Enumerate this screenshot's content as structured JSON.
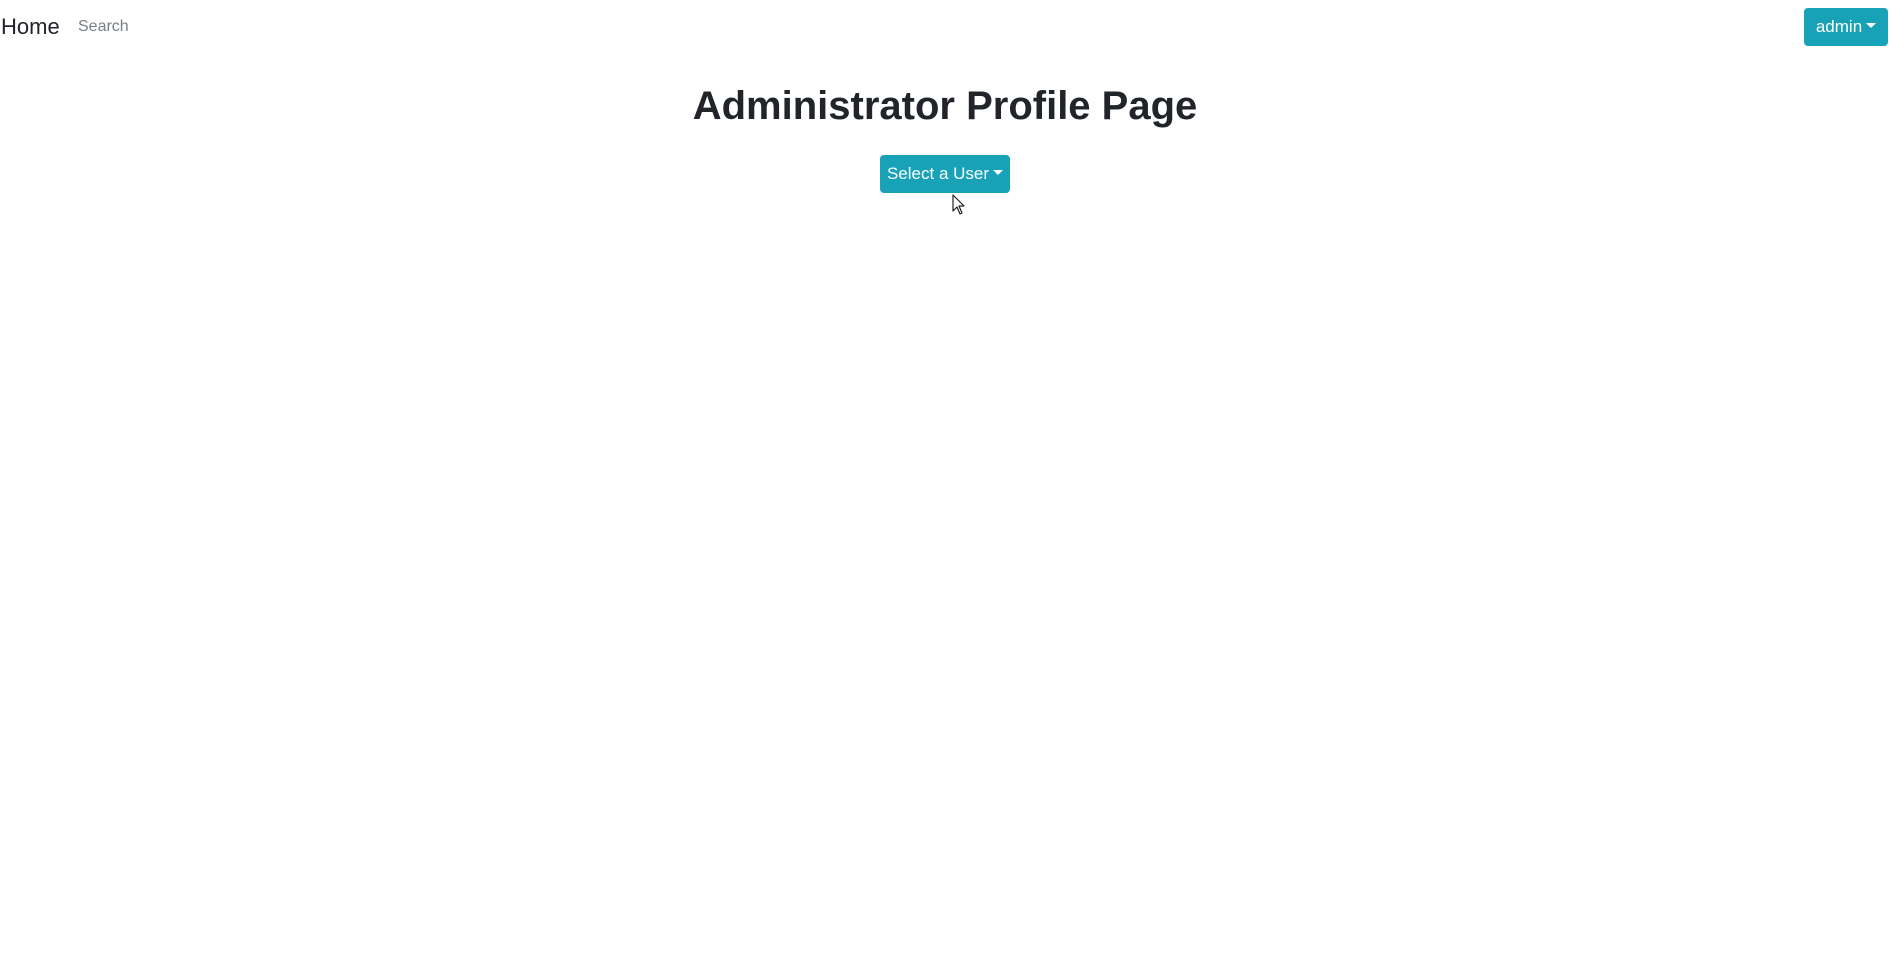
{
  "navbar": {
    "brand": "Home",
    "search_placeholder": "Search",
    "user_menu_label": "admin"
  },
  "main": {
    "title": "Administrator Profile Page",
    "select_user_label": "Select a User"
  },
  "colors": {
    "accent": "#17a2b8",
    "text": "#212529",
    "background": "#ffffff"
  }
}
